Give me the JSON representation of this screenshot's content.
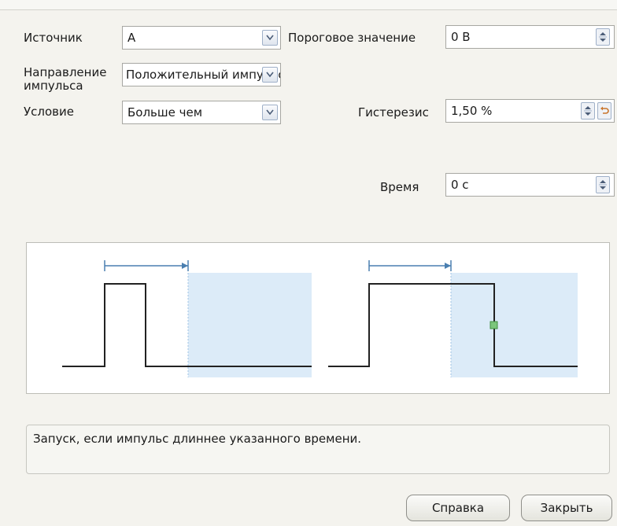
{
  "form": {
    "source_label": "Источник",
    "source_value": "A",
    "threshold_label": "Пороговое значение",
    "threshold_value": "0 В",
    "direction_label_1": "Направление",
    "direction_label_2": "импульса",
    "direction_value": "Положительный импульс",
    "condition_label": "Условие",
    "condition_value": "Больше чем",
    "hysteresis_label": "Гистерезис",
    "hysteresis_value": "1,50 %",
    "time_label": "Время",
    "time_value": "0 с"
  },
  "description": "Запуск, если импульс длиннее указанного времени.",
  "buttons": {
    "help": "Справка",
    "close": "Закрыть"
  },
  "icons": {
    "dropdown": "chevron-down-icon",
    "spinner": "spinner-arrows-icon",
    "reset": "undo-icon"
  },
  "colors": {
    "highlight_region": "#dcebf8",
    "marker": "#7bc67b",
    "time_arrow": "#4a7fb0"
  }
}
